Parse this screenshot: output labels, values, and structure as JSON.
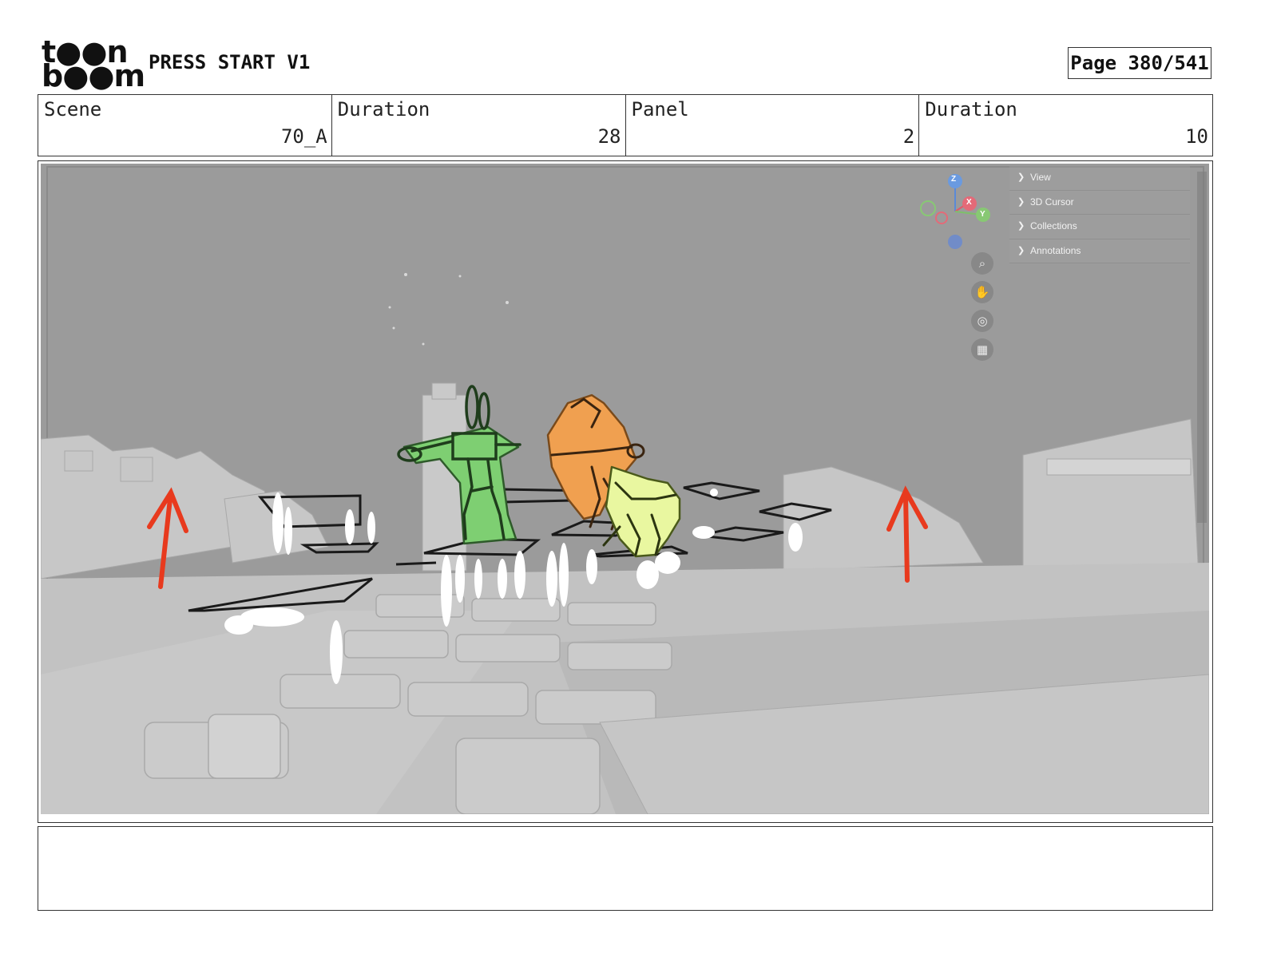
{
  "header": {
    "logo_line1": "t●●n",
    "logo_line2": "b●●m",
    "project_title": "PRESS START V1",
    "page_label": "Page 380/541"
  },
  "info": {
    "scene_label": "Scene",
    "scene_value": "70_A",
    "scene_duration_label": "Duration",
    "scene_duration_value": "28",
    "panel_label": "Panel",
    "panel_value": "2",
    "panel_duration_label": "Duration",
    "panel_duration_value": "10"
  },
  "viewport": {
    "menu_items": [
      "View",
      "3D Cursor",
      "Collections",
      "Annotations"
    ],
    "gizmo_axes": [
      "Z",
      "X",
      "Y"
    ],
    "tool_icons": [
      "zoom-icon",
      "hand-pan-icon",
      "camera-icon",
      "grid-perspective-icon"
    ],
    "colors": {
      "sky": "#9a9a9a",
      "ground": "#c4c4c4",
      "arrow": "#e83a1e",
      "character_green": "#7ecf72",
      "character_orange": "#f0a050",
      "character_yellow": "#e9f7a0"
    }
  },
  "notes": {
    "text": ""
  }
}
